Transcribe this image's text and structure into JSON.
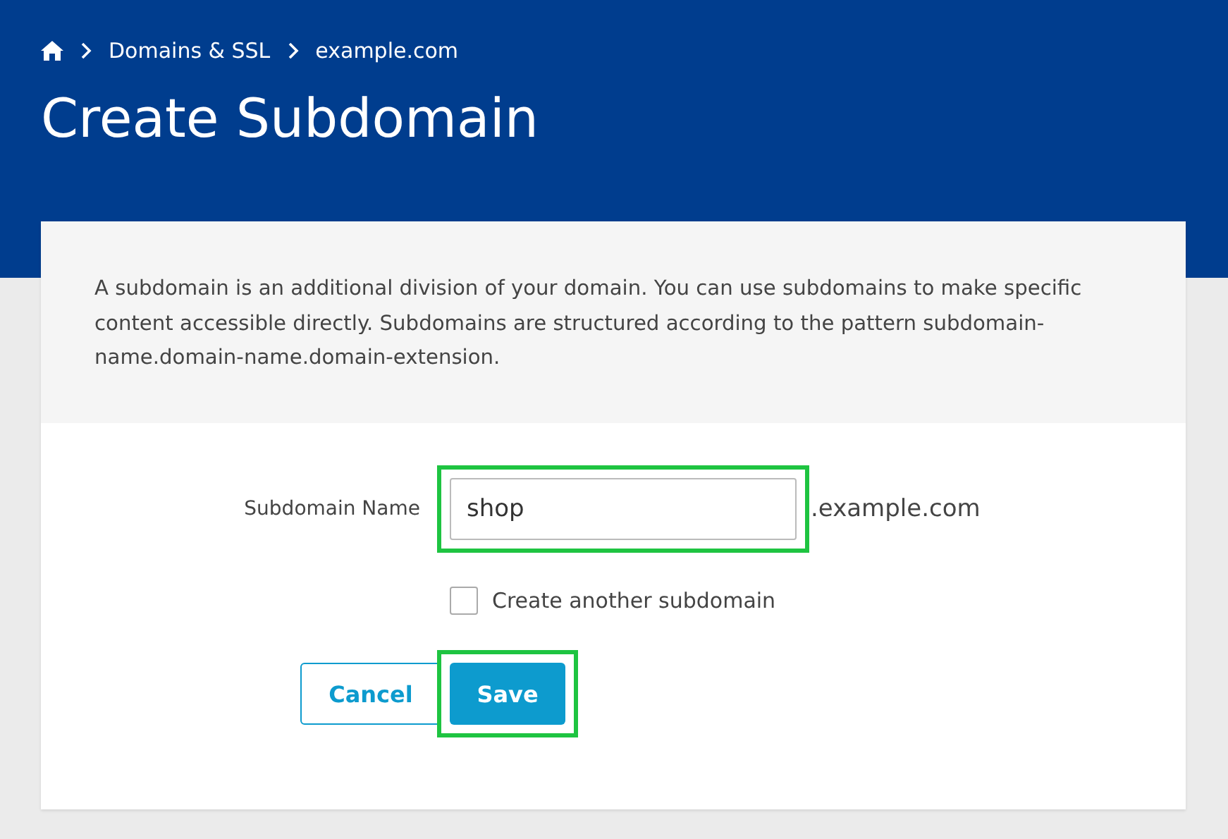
{
  "breadcrumb": [
    {
      "label": "Domains & SSL"
    },
    {
      "label": "example.com"
    }
  ],
  "title": "Create Subdomain",
  "description": "A subdomain is an additional division of your domain. You can use subdomains to make specific content accessible directly. Subdomains are structured according to the pattern subdomain-name.domain-name.domain-extension.",
  "subdomain_field": {
    "label": "Subdomain Name",
    "value": "shop",
    "suffix": ".example.com",
    "highlighted": true
  },
  "create_another": {
    "label": "Create another subdomain",
    "checked": false
  },
  "buttons": [
    {
      "label": "Cancel",
      "kind": "secondary",
      "highlighted": false
    },
    {
      "label": "Save",
      "kind": "primary",
      "highlighted": true
    }
  ]
}
